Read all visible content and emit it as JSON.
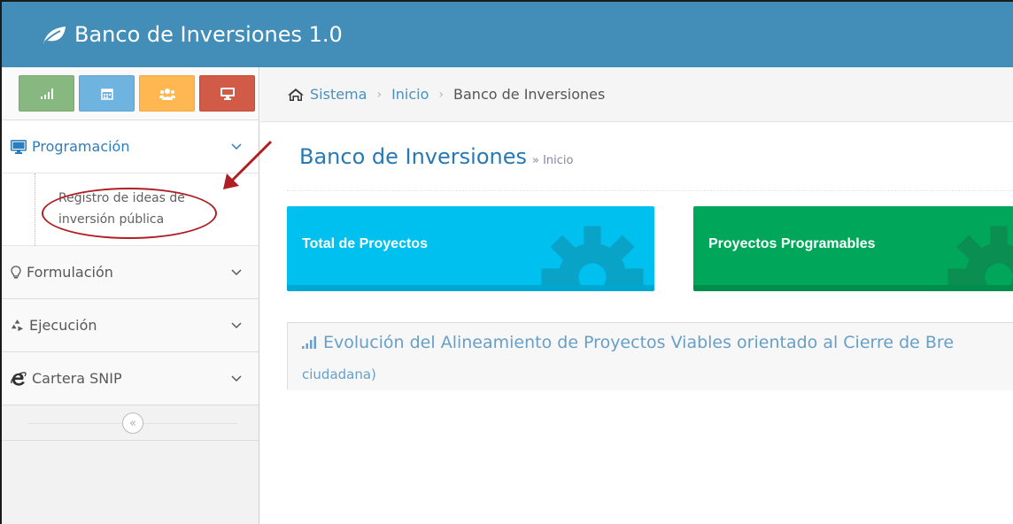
{
  "navbar": {
    "brand_icon": "leaf-icon",
    "brand_title": "Banco de Inversiones 1.0",
    "color": "#438eb9"
  },
  "shortcuts": [
    {
      "icon": "signal-icon",
      "color": "#87b87f"
    },
    {
      "icon": "calendar-icon",
      "color": "#6fb3e0"
    },
    {
      "icon": "users-icon",
      "color": "#ffb752"
    },
    {
      "icon": "desktop-icon",
      "color": "#d15b47"
    }
  ],
  "sidebar": {
    "items": [
      {
        "icon": "desktop-icon",
        "label": "Programación",
        "active": true
      },
      {
        "icon": "lightbulb-icon",
        "label": "Formulación"
      },
      {
        "icon": "recycle-icon",
        "label": "Ejecución"
      },
      {
        "icon": "ie-icon",
        "label": "Cartera SNIP"
      }
    ],
    "submenu": {
      "label": "Registro de ideas de inversión pública"
    }
  },
  "breadcrumbs": {
    "home_icon": "home-icon",
    "items": [
      "Sistema",
      "Inicio",
      "Banco de Inversiones"
    ]
  },
  "page": {
    "title": "Banco de Inversiones",
    "subtitle": "» Inicio"
  },
  "stats": [
    {
      "label": "Total de Proyectos",
      "color": "#00c0ef",
      "icon": "gear-icon"
    },
    {
      "label": "Proyectos Programables",
      "color": "#00a65a",
      "icon": "gear-icon"
    }
  ],
  "panel": {
    "icon": "signal-icon",
    "title": "Evolución del Alineamiento de Proyectos Viables orientado al Cierre de Bre",
    "title_line2": "ciudadana)"
  },
  "annotation": {
    "color": "#b01e24"
  }
}
